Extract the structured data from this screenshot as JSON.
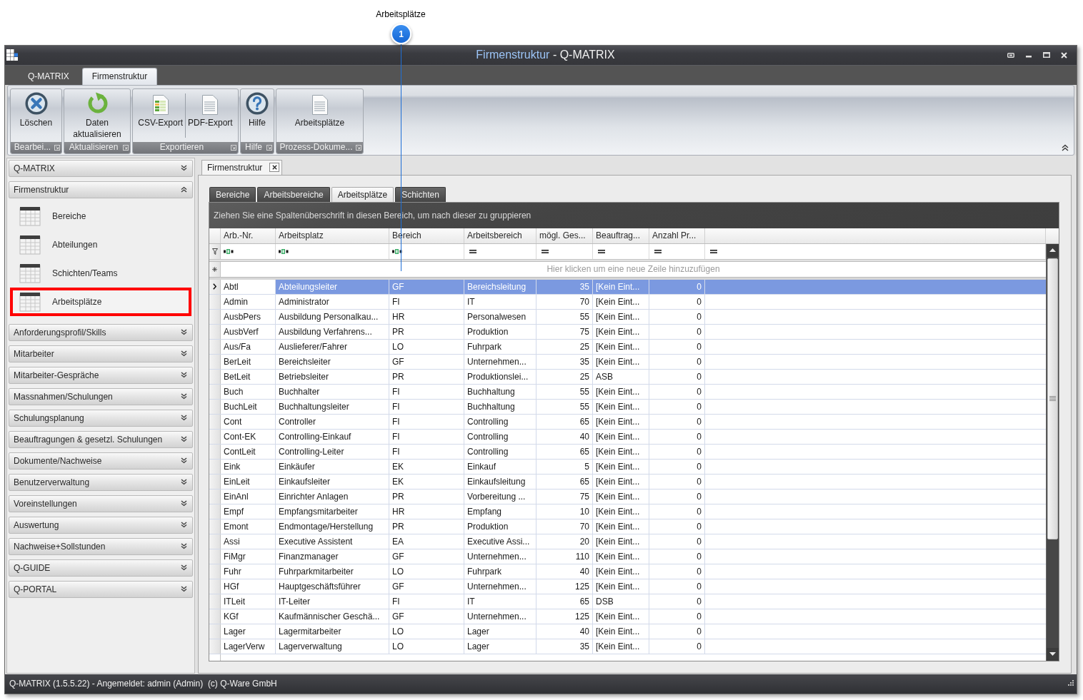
{
  "annotation": {
    "label": "Arbeitsplätze",
    "number": "1"
  },
  "window": {
    "title": {
      "document": "Firmenstruktur",
      "rest": " - Q-MATRIX"
    }
  },
  "ribbon": {
    "tabs": [
      {
        "label": "Q-MATRIX",
        "selected": false
      },
      {
        "label": "Firmenstruktur",
        "selected": true
      }
    ],
    "groups": [
      {
        "label": "Bearbei...",
        "buttons": [
          {
            "kind": "delete",
            "label": "Löschen"
          }
        ]
      },
      {
        "label": "Aktualisieren",
        "buttons": [
          {
            "kind": "refresh",
            "label": "Daten aktualisieren"
          }
        ]
      },
      {
        "label": "Exportieren",
        "buttons": [
          {
            "kind": "csv",
            "label": "CSV-Export"
          },
          {
            "kind": "pdf",
            "label": "PDF-Export"
          }
        ]
      },
      {
        "label": "Hilfe",
        "buttons": [
          {
            "kind": "help",
            "label": "Hilfe"
          }
        ]
      },
      {
        "label": "Prozess-Dokume...",
        "buttons": [
          {
            "kind": "document",
            "label": "Arbeitsplätze"
          }
        ]
      }
    ]
  },
  "navigation": [
    {
      "label": "Q-MATRIX",
      "expanded": false
    },
    {
      "label": "Firmenstruktur",
      "expanded": true,
      "items": [
        {
          "label": "Bereiche",
          "selected": false
        },
        {
          "label": "Abteilungen",
          "selected": false
        },
        {
          "label": "Schichten/Teams",
          "selected": false
        },
        {
          "label": "Arbeitsplätze",
          "selected": true
        }
      ]
    },
    {
      "label": "Anforderungsprofil/Skills",
      "expanded": false
    },
    {
      "label": "Mitarbeiter",
      "expanded": false
    },
    {
      "label": "Mitarbeiter-Gespräche",
      "expanded": false
    },
    {
      "label": "Massnahmen/Schulungen",
      "expanded": false
    },
    {
      "label": "Schulungsplanung",
      "expanded": false
    },
    {
      "label": "Beauftragungen & gesetzl. Schulungen",
      "expanded": false
    },
    {
      "label": "Dokumente/Nachweise",
      "expanded": false
    },
    {
      "label": "Benutzerverwaltung",
      "expanded": false
    },
    {
      "label": "Voreinstellungen",
      "expanded": false
    },
    {
      "label": "Auswertung",
      "expanded": false
    },
    {
      "label": "Nachweise+Sollstunden",
      "expanded": false
    },
    {
      "label": "Q-GUIDE",
      "expanded": false
    },
    {
      "label": "Q-PORTAL",
      "expanded": false
    }
  ],
  "document_tabs": [
    {
      "label": "Firmenstruktur",
      "selected": true
    }
  ],
  "tabs": [
    {
      "label": "Bereiche",
      "selected": false
    },
    {
      "label": "Arbeitsbereiche",
      "selected": false
    },
    {
      "label": "Arbeitsplätze",
      "selected": true
    },
    {
      "label": "Schichten",
      "selected": false
    }
  ],
  "grid": {
    "group_panel_hint": "Ziehen Sie eine Spaltenüberschrift in diesen Bereich, um nach dieser zu gruppieren",
    "columns": [
      {
        "label": "Arb.-Nr.",
        "kind": "text",
        "focused": true
      },
      {
        "label": "Arbeitsplatz",
        "kind": "text",
        "focused": false
      },
      {
        "label": "Bereich",
        "kind": "text",
        "focused": false
      },
      {
        "label": "Arbeitsbereich",
        "kind": "text",
        "focused": false
      },
      {
        "label": "mögl. Ges...",
        "kind": "number",
        "focused": false
      },
      {
        "label": "Beauftrag...",
        "kind": "text",
        "focused": false
      },
      {
        "label": "Anzahl Pr...",
        "kind": "number",
        "focused": false
      }
    ],
    "filters": [
      {
        "kind": "text"
      },
      {
        "kind": "text"
      },
      {
        "kind": "text"
      },
      {
        "kind": "equals"
      },
      {
        "kind": "equals"
      },
      {
        "kind": "equals"
      },
      {
        "kind": "equals"
      },
      {
        "kind": "equals"
      }
    ],
    "new_row_hint": "Hier klicken um eine neue Zeile hinzuzufügen",
    "rows": [
      {
        "selected": true,
        "cells": [
          "Abtl",
          "Abteilungsleiter",
          "GF",
          "Bereichsleitung",
          "35",
          "[Kein Eint...",
          "0"
        ]
      },
      {
        "selected": false,
        "cells": [
          "Admin",
          "Administrator",
          "FI",
          "IT",
          "70",
          "[Kein Eint...",
          "0"
        ]
      },
      {
        "selected": false,
        "cells": [
          "AusbPers",
          "Ausbildung Personalkau...",
          "HR",
          "Personalwesen",
          "55",
          "[Kein Eint...",
          "0"
        ]
      },
      {
        "selected": false,
        "cells": [
          "AusbVerf",
          "Ausbildung Verfahrens...",
          "PR",
          "Produktion",
          "75",
          "[Kein Eint...",
          "0"
        ]
      },
      {
        "selected": false,
        "cells": [
          "Aus/Fa",
          "Auslieferer/Fahrer",
          "LO",
          "Fuhrpark",
          "25",
          "[Kein Eint...",
          "0"
        ]
      },
      {
        "selected": false,
        "cells": [
          "BerLeit",
          "Bereichsleiter",
          "GF",
          "Unternehmen...",
          "35",
          "[Kein Eint...",
          "0"
        ]
      },
      {
        "selected": false,
        "cells": [
          "BetLeit",
          "Betriebsleiter",
          "PR",
          "Produktionslei...",
          "25",
          "ASB",
          "0"
        ]
      },
      {
        "selected": false,
        "cells": [
          "Buch",
          "Buchhalter",
          "FI",
          "Buchhaltung",
          "55",
          "[Kein Eint...",
          "0"
        ]
      },
      {
        "selected": false,
        "cells": [
          "BuchLeit",
          "Buchhaltungsleiter",
          "FI",
          "Buchhaltung",
          "55",
          "[Kein Eint...",
          "0"
        ]
      },
      {
        "selected": false,
        "cells": [
          "Cont",
          "Controller",
          "FI",
          "Controlling",
          "65",
          "[Kein Eint...",
          "0"
        ]
      },
      {
        "selected": false,
        "cells": [
          "Cont-EK",
          "Controlling-Einkauf",
          "FI",
          "Controlling",
          "40",
          "[Kein Eint...",
          "0"
        ]
      },
      {
        "selected": false,
        "cells": [
          "ContLeit",
          "Controlling-Leiter",
          "FI",
          "Controlling",
          "65",
          "[Kein Eint...",
          "0"
        ]
      },
      {
        "selected": false,
        "cells": [
          "Eink",
          "Einkäufer",
          "EK",
          "Einkauf",
          "5",
          "[Kein Eint...",
          "0"
        ]
      },
      {
        "selected": false,
        "cells": [
          "EinLeit",
          "Einkaufsleiter",
          "EK",
          "Einkaufsleitung",
          "65",
          "[Kein Eint...",
          "0"
        ]
      },
      {
        "selected": false,
        "cells": [
          "EinAnl",
          "Einrichter Anlagen",
          "PR",
          "Vorbereitung ...",
          "75",
          "[Kein Eint...",
          "0"
        ]
      },
      {
        "selected": false,
        "cells": [
          "Empf",
          "Empfangsmitarbeiter",
          "HR",
          "Empfang",
          "10",
          "[Kein Eint...",
          "0"
        ]
      },
      {
        "selected": false,
        "cells": [
          "Emont",
          "Endmontage/Herstellung",
          "PR",
          "Produktion",
          "70",
          "[Kein Eint...",
          "0"
        ]
      },
      {
        "selected": false,
        "cells": [
          "Assi",
          "Executive Assistent",
          "EA",
          "Executive Assi...",
          "20",
          "[Kein Eint...",
          "0"
        ]
      },
      {
        "selected": false,
        "cells": [
          "FiMgr",
          "Finanzmanager",
          "GF",
          "Unternehmen...",
          "110",
          "[Kein Eint...",
          "0"
        ]
      },
      {
        "selected": false,
        "cells": [
          "Fuhr",
          "Fuhrparkmitarbeiter",
          "LO",
          "Fuhrpark",
          "40",
          "[Kein Eint...",
          "0"
        ]
      },
      {
        "selected": false,
        "cells": [
          "HGf",
          "Hauptgeschäftsführer",
          "GF",
          "Unternehmen...",
          "125",
          "[Kein Eint...",
          "0"
        ]
      },
      {
        "selected": false,
        "cells": [
          "ITLeit",
          "IT-Leiter",
          "FI",
          "IT",
          "65",
          "DSB",
          "0"
        ]
      },
      {
        "selected": false,
        "cells": [
          "KGf",
          "Kaufmännischer Geschä...",
          "GF",
          "Unternehmen...",
          "125",
          "[Kein Eint...",
          "0"
        ]
      },
      {
        "selected": false,
        "cells": [
          "Lager",
          "Lagermitarbeiter",
          "LO",
          "Lager",
          "40",
          "[Kein Eint...",
          "0"
        ]
      },
      {
        "selected": false,
        "cells": [
          "LagerVerw",
          "Lagerverwaltung",
          "LO",
          "Lager",
          "35",
          "[Kein Eint...",
          "0"
        ]
      }
    ]
  },
  "status_bar": "Q-MATRIX (1.5.5.22) - Angemeldet: admin (Admin)  (c) Q-Ware GmbH"
}
